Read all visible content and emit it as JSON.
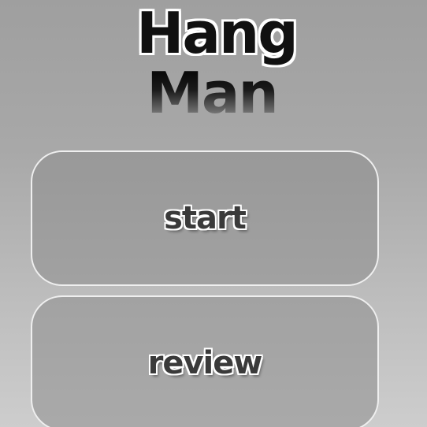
{
  "app": {
    "title_line1": "Hang",
    "title_line2": "Man"
  },
  "menu": {
    "start_label": "start",
    "review_label": "review"
  },
  "colors": {
    "background_top": "#9f9f9f",
    "background_bottom": "#cdcdcd",
    "button_border": "#efefef",
    "label_fill": "#3a3a3a"
  }
}
